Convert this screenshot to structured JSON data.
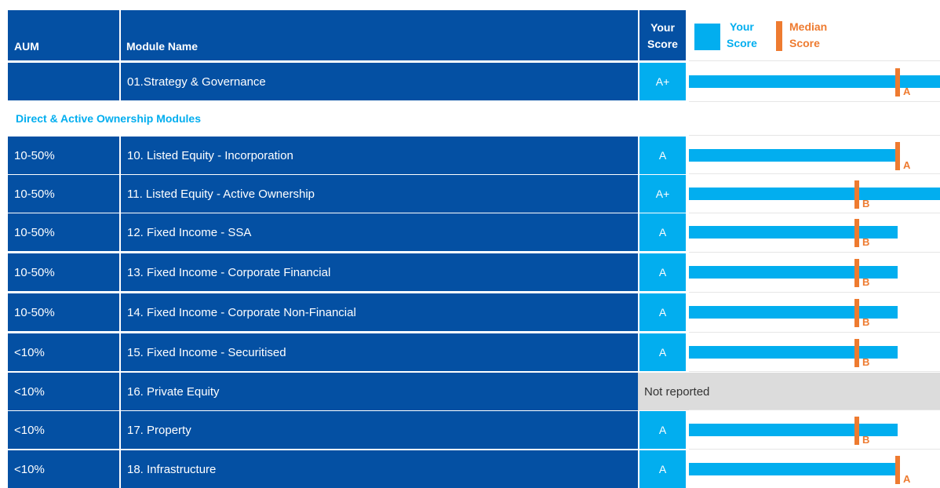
{
  "header": {
    "aum": "AUM",
    "module_name": "Module Name",
    "your_score_line1": "Your",
    "your_score_line2": "Score"
  },
  "legend": {
    "your_score_line1": "Your",
    "your_score_line2": "Score",
    "median_line1": "Median",
    "median_line2": "Score"
  },
  "section_title": "Direct & Active Ownership Modules",
  "colors": {
    "header_bg": "#0450a3",
    "score_bg": "#02aeef",
    "median": "#ee7b30",
    "not_reported_bg": "#dcdcdc"
  },
  "rows": [
    {
      "aum": "",
      "module": "01.Strategy & Governance",
      "score": "A+",
      "score_fraction": 1.0,
      "median_fraction": 0.83,
      "median_grade": "A"
    },
    {
      "aum": "10-50%",
      "module": "10. Listed Equity - Incorporation",
      "score": "A",
      "score_fraction": 0.83,
      "median_fraction": 0.83,
      "median_grade": "A"
    },
    {
      "aum": "10-50%",
      "module": "11. Listed Equity - Active Ownership",
      "score": "A+",
      "score_fraction": 1.0,
      "median_fraction": 0.67,
      "median_grade": "B"
    },
    {
      "aum": "10-50%",
      "module": "12. Fixed Income - SSA",
      "score": "A",
      "score_fraction": 0.83,
      "median_fraction": 0.67,
      "median_grade": "B"
    },
    {
      "aum": "10-50%",
      "module": "13. Fixed Income - Corporate Financial",
      "score": "A",
      "score_fraction": 0.83,
      "median_fraction": 0.67,
      "median_grade": "B"
    },
    {
      "aum": "10-50%",
      "module": "14. Fixed Income - Corporate Non-Financial",
      "score": "A",
      "score_fraction": 0.83,
      "median_fraction": 0.67,
      "median_grade": "B"
    },
    {
      "aum": "<10%",
      "module": "15. Fixed Income - Securitised",
      "score": "A",
      "score_fraction": 0.83,
      "median_fraction": 0.67,
      "median_grade": "B"
    },
    {
      "aum": "<10%",
      "module": "16. Private Equity",
      "score": "Not reported",
      "not_reported": true
    },
    {
      "aum": "<10%",
      "module": "17. Property",
      "score": "A",
      "score_fraction": 0.83,
      "median_fraction": 0.67,
      "median_grade": "B"
    },
    {
      "aum": "<10%",
      "module": "18. Infrastructure",
      "score": "A",
      "score_fraction": 0.83,
      "median_fraction": 0.83,
      "median_grade": "A"
    }
  ]
}
